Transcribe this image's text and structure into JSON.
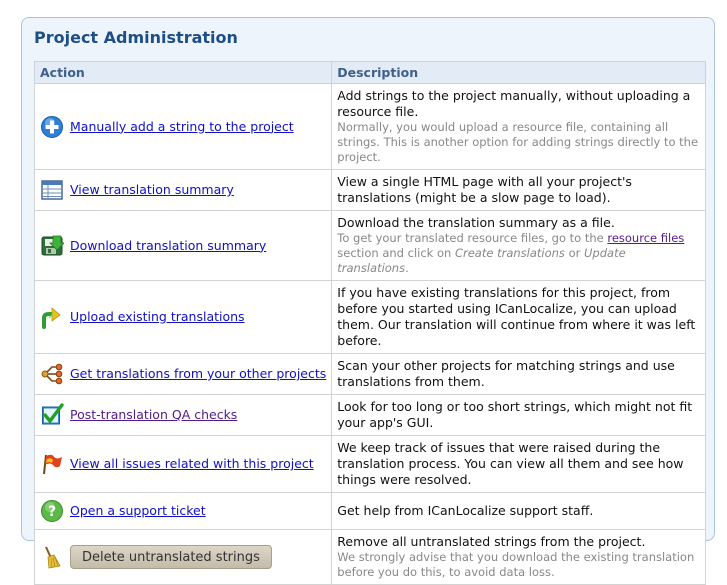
{
  "panel": {
    "title": "Project Administration"
  },
  "table": {
    "headers": {
      "action": "Action",
      "description": "Description"
    },
    "rows": [
      {
        "icon": "add-icon",
        "action": "Manually add a string to the project",
        "main": "Add strings to the project manually, without uploading a resource file.",
        "note": "Normally, you would upload a resource file, containing all strings. This is another option for adding strings directly to the project."
      },
      {
        "icon": "table-icon",
        "action": "View translation summary",
        "main": "View a single HTML page with all your project's translations (might be a slow page to load)."
      },
      {
        "icon": "download-icon",
        "action": "Download translation summary",
        "main": "Download the translation summary as a file.",
        "note_parts": {
          "p1": "To get your translated resource files, go to the ",
          "link": "resource files",
          "p2": " section and click on ",
          "em1": "Create translations",
          "p3": " or ",
          "em2": "Update translations",
          "p4": "."
        }
      },
      {
        "icon": "upload-icon",
        "action": "Upload existing translations",
        "main": "If you have existing translations for this project, from before you started using ICanLocalize, you can upload them. Our translation will continue from where it was left before."
      },
      {
        "icon": "share-icon",
        "action": "Get translations from your other projects",
        "main": "Scan your other projects for matching strings and use translations from them."
      },
      {
        "icon": "check-icon",
        "action": "Post-translation QA checks",
        "main": "Look for too long or too short strings, which might not fit your app's GUI."
      },
      {
        "icon": "flag-icon",
        "action": "View all issues related with this project",
        "main": "We keep track of issues that were raised during the translation process. You can view all them and see how things were resolved."
      },
      {
        "icon": "help-icon",
        "action": "Open a support ticket",
        "main": "Get help from ICanLocalize support staff."
      },
      {
        "icon": "broom-icon",
        "action": "Delete untranslated strings",
        "main": "Remove all untranslated strings from the project.",
        "note": "We strongly advise that you download the existing translation before you do this, to avoid data loss."
      }
    ]
  }
}
